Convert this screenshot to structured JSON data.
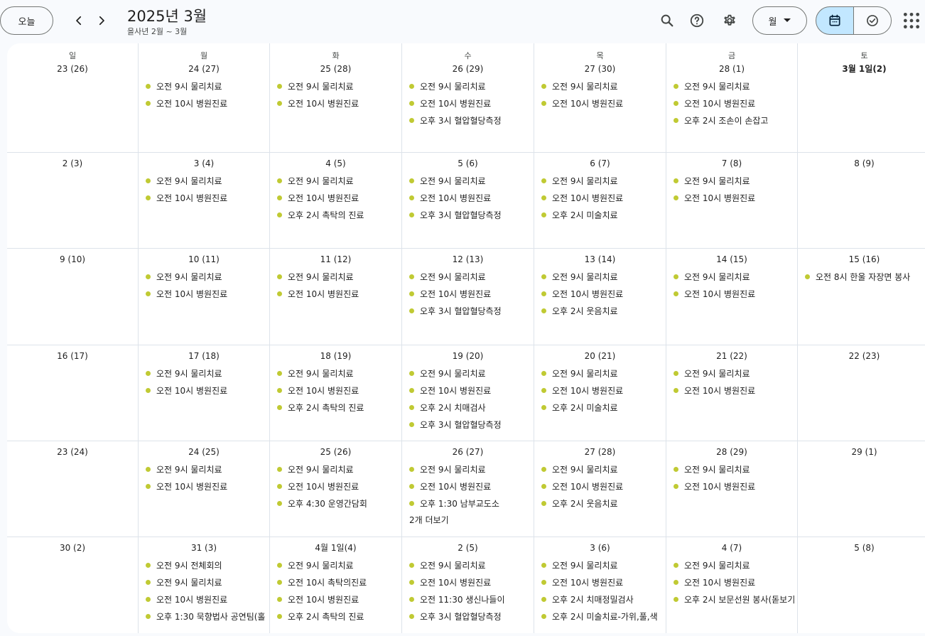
{
  "toolbar": {
    "today_label": "오늘",
    "title": "2025년 3월",
    "subtitle": "을사년 2월 ~ 3월",
    "view_label": "월"
  },
  "colors": {
    "event_dot": "#c0ca33",
    "selected_view": "#c2e7ff"
  },
  "weekdays": [
    "일",
    "월",
    "화",
    "수",
    "목",
    "금",
    "토"
  ],
  "weeks": [
    [
      {
        "day": "23 (26)",
        "events": []
      },
      {
        "day": "24 (27)",
        "events": [
          "오전 9시 물리치료",
          "오전 10시 병원진료"
        ]
      },
      {
        "day": "25 (28)",
        "events": [
          "오전 9시 물리치료",
          "오전 10시 병원진료"
        ]
      },
      {
        "day": "26 (29)",
        "events": [
          "오전 9시 물리치료",
          "오전 10시 병원진료",
          "오후 3시 혈압혈당측정"
        ]
      },
      {
        "day": "27 (30)",
        "events": [
          "오전 9시 물리치료",
          "오전 10시 병원진료"
        ]
      },
      {
        "day": "28 (1)",
        "events": [
          "오전 9시 물리치료",
          "오전 10시 병원진료",
          "오후 2시 조손이 손잡고"
        ]
      },
      {
        "day": "3월 1일(2)",
        "bold": true,
        "events": []
      }
    ],
    [
      {
        "day": "2 (3)",
        "events": []
      },
      {
        "day": "3 (4)",
        "events": [
          "오전 9시 물리치료",
          "오전 10시 병원진료"
        ]
      },
      {
        "day": "4 (5)",
        "events": [
          "오전 9시 물리치료",
          "오전 10시 병원진료",
          "오후 2시 촉탁의 진료"
        ]
      },
      {
        "day": "5 (6)",
        "events": [
          "오전 9시 물리치료",
          "오전 10시 병원진료",
          "오후 3시 혈압혈당측정"
        ]
      },
      {
        "day": "6 (7)",
        "events": [
          "오전 9시 물리치료",
          "오전 10시 병원진료",
          "오후 2시 미술치료"
        ]
      },
      {
        "day": "7 (8)",
        "events": [
          "오전 9시 물리치료",
          "오전 10시 병원진료"
        ]
      },
      {
        "day": "8 (9)",
        "events": []
      }
    ],
    [
      {
        "day": "9 (10)",
        "events": []
      },
      {
        "day": "10 (11)",
        "events": [
          "오전 9시 물리치료",
          "오전 10시 병원진료"
        ]
      },
      {
        "day": "11 (12)",
        "events": [
          "오전 9시 물리치료",
          "오전 10시 병원진료"
        ]
      },
      {
        "day": "12 (13)",
        "events": [
          "오전 9시 물리치료",
          "오전 10시 병원진료",
          "오후 3시 혈압혈당측정"
        ]
      },
      {
        "day": "13 (14)",
        "events": [
          "오전 9시 물리치료",
          "오전 10시 병원진료",
          "오후 2시 웃음치료"
        ]
      },
      {
        "day": "14 (15)",
        "events": [
          "오전 9시 물리치료",
          "오전 10시 병원진료"
        ]
      },
      {
        "day": "15 (16)",
        "events": [
          "오전 8시 한울 자장면 봉사"
        ]
      }
    ],
    [
      {
        "day": "16 (17)",
        "events": []
      },
      {
        "day": "17 (18)",
        "events": [
          "오전 9시 물리치료",
          "오전 10시 병원진료"
        ]
      },
      {
        "day": "18 (19)",
        "events": [
          "오전 9시 물리치료",
          "오전 10시 병원진료",
          "오후 2시 촉탁의 진료"
        ]
      },
      {
        "day": "19 (20)",
        "events": [
          "오전 9시 물리치료",
          "오전 10시 병원진료",
          "오후 2시 치매검사",
          "오후 3시 혈압혈당측정"
        ]
      },
      {
        "day": "20 (21)",
        "events": [
          "오전 9시 물리치료",
          "오전 10시 병원진료",
          "오후 2시 미술치료"
        ]
      },
      {
        "day": "21 (22)",
        "events": [
          "오전 9시 물리치료",
          "오전 10시 병원진료"
        ]
      },
      {
        "day": "22 (23)",
        "events": []
      }
    ],
    [
      {
        "day": "23 (24)",
        "events": []
      },
      {
        "day": "24 (25)",
        "events": [
          "오전 9시 물리치료",
          "오전 10시 병원진료"
        ]
      },
      {
        "day": "25 (26)",
        "events": [
          "오전 9시 물리치료",
          "오전 10시 병원진료",
          "오후 4:30 운영간담회"
        ]
      },
      {
        "day": "26 (27)",
        "events": [
          "오전 9시 물리치료",
          "오전 10시 병원진료",
          "오후 1:30 남부교도소"
        ],
        "more": "2개 더보기"
      },
      {
        "day": "27 (28)",
        "events": [
          "오전 9시 물리치료",
          "오전 10시 병원진료",
          "오후 2시 웃음치료"
        ]
      },
      {
        "day": "28 (29)",
        "events": [
          "오전 9시 물리치료",
          "오전 10시 병원진료"
        ]
      },
      {
        "day": "29 (1)",
        "events": []
      }
    ],
    [
      {
        "day": "30 (2)",
        "events": []
      },
      {
        "day": "31 (3)",
        "events": [
          "오전 9시 전체회의",
          "오전 9시 물리치료",
          "오전 10시 병원진료",
          "오후 1:30 묵향법사 공연팀(홀"
        ]
      },
      {
        "day": "4월 1일(4)",
        "events": [
          "오전 9시 물리치료",
          "오전 10시 촉탁의진료",
          "오전 10시 병원진료",
          "오후 2시 촉탁의 진료"
        ]
      },
      {
        "day": "2 (5)",
        "events": [
          "오전 9시 물리치료",
          "오전 10시 병원진료",
          "오전 11:30 생신나들이",
          "오후 3시 혈압혈당측정"
        ]
      },
      {
        "day": "3 (6)",
        "events": [
          "오전 9시 물리치료",
          "오전 10시 병원진료",
          "오후 2시 치매정밀검사",
          "오후 2시 미술치료-가위,풀,색"
        ]
      },
      {
        "day": "4 (7)",
        "events": [
          "오전 9시 물리치료",
          "오전 10시 병원진료",
          "오후 2시 보문선원 봉사(돋보기"
        ]
      },
      {
        "day": "5 (8)",
        "events": []
      }
    ]
  ]
}
